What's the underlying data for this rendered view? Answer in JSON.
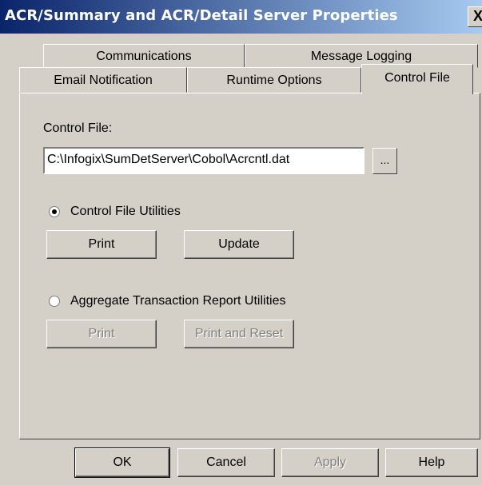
{
  "window": {
    "title": "ACR/Summary and ACR/Detail Server Properties",
    "close_label": "X"
  },
  "tabs": {
    "communications": "Communications",
    "message_logging": "Message Logging",
    "email_notification": "Email Notification",
    "runtime_options": "Runtime Options",
    "control_file": "Control File"
  },
  "control_file": {
    "label": "Control File:",
    "path_value": "C:\\Infogix\\SumDetServer\\Cobol\\Acrcntl.dat",
    "browse_label": "..."
  },
  "control_file_utilities": {
    "label": "Control File Utilities",
    "selected": true,
    "print_label": "Print",
    "update_label": "Update"
  },
  "aggregate_utilities": {
    "label": "Aggregate Transaction Report Utilities",
    "selected": false,
    "print_label": "Print",
    "print_reset_label": "Print and Reset"
  },
  "footer": {
    "ok": "OK",
    "cancel": "Cancel",
    "apply": "Apply",
    "help": "Help"
  }
}
